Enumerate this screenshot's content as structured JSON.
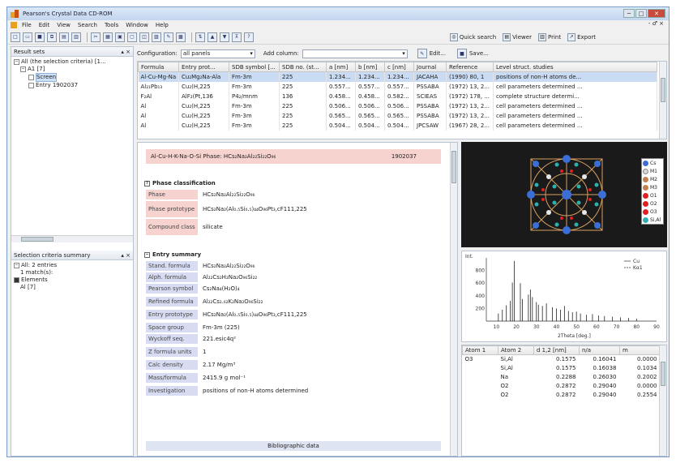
{
  "window": {
    "title": "Pearson's Crystal Data CD-ROM",
    "min": "─",
    "max": "□",
    "close": "✕"
  },
  "menu": {
    "items": [
      "File",
      "Edit",
      "View",
      "Search",
      "Tools",
      "Window",
      "Help"
    ],
    "right": "- ♂ ×"
  },
  "toolbar": {
    "quick_search": "Quick search",
    "viewer": "Viewer",
    "print": "Print",
    "export": "Export"
  },
  "left": {
    "result_sets_title": "Result sets",
    "tree": [
      "All (the selection criteria) [1...",
      "A1 [7]",
      "Screen",
      "Entry 1902037"
    ],
    "criteria_title": "Selection criteria summary",
    "criteria": [
      "All: 2 entries",
      "1 match(s):",
      "Elements",
      "Al [7]"
    ]
  },
  "config": {
    "label": "Configuration:",
    "value": "all panels",
    "add_label": "Add column:",
    "add_value": "",
    "edit": "Edit...",
    "save": "Save..."
  },
  "grid": {
    "columns": [
      "Formula",
      "Entry prot...",
      "SDB symbol [...",
      "SDB no. (st...",
      "a [nm]",
      "b [nm]",
      "c [nm]",
      "Journal",
      "Reference",
      "Level struct. studies"
    ],
    "rows": [
      [
        "Al-Cu-Mg-Na",
        "Cu₂Mg₂Na-Ala",
        "Fm-3m",
        "225",
        "1.234...",
        "1.234...",
        "1.234...",
        "JACAHA",
        "(1990) 80, 1",
        "positions of non-H atoms de..."
      ],
      [
        "Al₂₁Pb₁₃",
        "Cu₂(H,225",
        "Fm-3m",
        "225",
        "0.557...",
        "0.557...",
        "0.557...",
        "PSSABA",
        "(1972) 13, 2...",
        "cell parameters determined ..."
      ],
      [
        "F₂Al",
        "AlF₂(Pt,136",
        "P4₂/mnm",
        "136",
        "0.458...",
        "0.458...",
        "0.582...",
        "SCIEAS",
        "(1972) 178, ...",
        "complete structure determi..."
      ],
      [
        "Al",
        "Cu₂(H,225",
        "Fm-3m",
        "225",
        "0.506...",
        "0.506...",
        "0.506...",
        "PSSABA",
        "(1972) 13, 2...",
        "cell parameters determined ..."
      ],
      [
        "Al",
        "Cu₂(H,225",
        "Fm-3m",
        "225",
        "0.565...",
        "0.565...",
        "0.565...",
        "PSSABA",
        "(1972) 13, 2...",
        "cell parameters determined ..."
      ],
      [
        "Al",
        "Cu₂(H,225",
        "Fm-3m",
        "225",
        "0.504...",
        "0.504...",
        "0.504...",
        "JPCSAW",
        "(1967) 28, 2...",
        "cell parameters determined ..."
      ]
    ]
  },
  "detail": {
    "header": "Al-Cu-H-K-Na-O-Si Phase: HCs₂Na₂Al₂₂Si₂₂O₉₆",
    "code": "1902037",
    "phase_title": "Phase classification",
    "phase_rows": [
      {
        "label": "Phase",
        "value": "HCs₂Na₂Al₂₂Si₂₂O₉₆"
      },
      {
        "label": "Phase prototype",
        "value": "HCs₂Na₂(Al₀.₅Si₀.₅)₄₄O₉₆Pt₃,cF111,225"
      },
      {
        "label": "Compound class",
        "value": "silicate"
      }
    ],
    "entry_title": "Entry summary",
    "entry_rows": [
      {
        "label": "Stand. formula",
        "value": "HCs₂Na₂Al₂₂Si₂₂O₉₆"
      },
      {
        "label": "Alph. formula",
        "value": "Al₂₂Cs₂H₂Na₂O₉₆Si₂₂"
      },
      {
        "label": "Pearson symbol",
        "value": "Cs₂Na₄(H₂O)₄"
      },
      {
        "label": "Refined formula",
        "value": "Al₂₂Cs₂.₆₂K₂Na₂O₉₆Si₂₂"
      },
      {
        "label": "Entry prototype",
        "value": "HCs₂Na₂(Al₀.₅Si₀.₅)₄₄O₉₆Pt₃,cF111,225"
      },
      {
        "label": "Space group",
        "value": "Fm-3m (225)"
      },
      {
        "label": "Wyckoff seq.",
        "value": "221.esic4q²"
      },
      {
        "label": "Z formula units",
        "value": "1"
      },
      {
        "label": "Calc density",
        "value": "2.17 Mg/m³"
      },
      {
        "label": "Mass/formula",
        "value": "2415.9 g mol⁻¹"
      },
      {
        "label": "Investigation",
        "value": "positions of non-H atoms determined"
      }
    ],
    "biblio": "Bibliographic data"
  },
  "structure_legend": [
    {
      "label": "Cs",
      "color": "#3b6fd6"
    },
    {
      "label": "M1",
      "color": "#d9d9d9"
    },
    {
      "label": "M2",
      "color": "#c08050"
    },
    {
      "label": "M3",
      "color": "#c08050"
    },
    {
      "label": "O1",
      "color": "#e02020"
    },
    {
      "label": "O2",
      "color": "#e02020"
    },
    {
      "label": "O3",
      "color": "#e02020"
    },
    {
      "label": "Si,Al",
      "color": "#2fb0b0"
    }
  ],
  "chart_data": {
    "type": "bar",
    "xlabel": "2Theta [deg.]",
    "ylabel": "Int.",
    "xlim": [
      5,
      90
    ],
    "ylim": [
      0,
      1000
    ],
    "yticks": [
      "200",
      "400",
      "600",
      "800"
    ],
    "xticks": [
      "10",
      "20",
      "30",
      "40",
      "50",
      "60",
      "70",
      "80",
      "90"
    ],
    "legend": [
      "Cu",
      "Kα1"
    ],
    "series": [
      {
        "x": [
          11,
          13,
          15,
          17,
          18,
          19,
          22,
          23,
          26,
          27,
          28,
          30,
          31,
          33,
          35,
          38,
          40,
          42,
          44,
          46,
          48,
          50,
          52,
          55,
          58,
          61,
          64,
          68,
          72,
          76,
          80
        ],
        "values": [
          120,
          180,
          250,
          320,
          610,
          950,
          600,
          350,
          420,
          500,
          380,
          300,
          260,
          240,
          280,
          220,
          200,
          180,
          240,
          160,
          140,
          150,
          120,
          100,
          110,
          90,
          80,
          70,
          60,
          50,
          40
        ]
      }
    ]
  },
  "bonds": {
    "columns": [
      "Atom 1",
      "Atom 2",
      "d 1,2 [nm]",
      "n/a",
      "m"
    ],
    "rows": [
      [
        "O3",
        "Si,Al",
        "0.1575",
        "0.16041",
        "0.0000"
      ],
      [
        "",
        "Si,Al",
        "0.1575",
        "0.16038",
        "0.1034"
      ],
      [
        "",
        "Na",
        "0.2288",
        "0.26030",
        "0.2002"
      ],
      [
        "",
        "O2",
        "0.2872",
        "0.29040",
        "0.0000"
      ],
      [
        "",
        "O2",
        "0.2872",
        "0.29040",
        "0.2554"
      ]
    ]
  }
}
